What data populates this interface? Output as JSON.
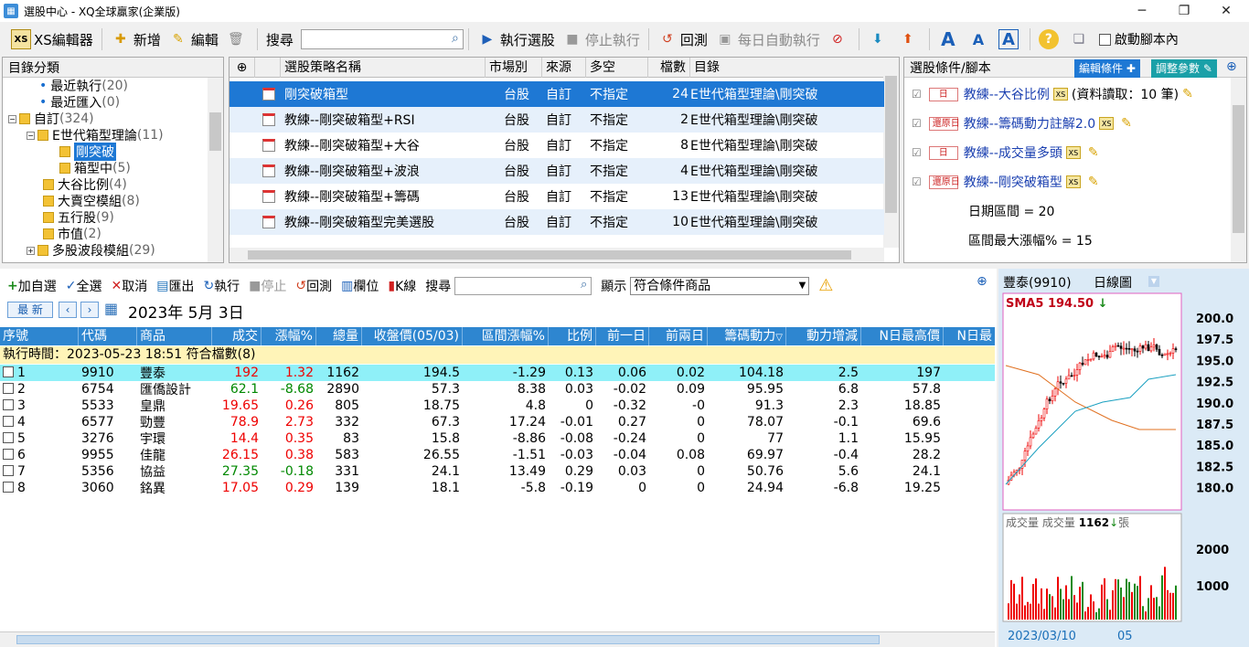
{
  "window": {
    "title": "選股中心 - XQ全球贏家(企業版)",
    "minimize": "─",
    "maximize": "❐",
    "close": "✕"
  },
  "toolbar": {
    "xs_editor": "XS編輯器",
    "add": "新增",
    "edit": "編輯",
    "search_label": "搜尋",
    "run": "執行選股",
    "stop": "停止執行",
    "backtest": "回測",
    "daily_auto": "每日自動執行",
    "autostart": "啟動腳本內"
  },
  "tree": {
    "header": "目錄分類",
    "items": [
      {
        "label": "最近執行",
        "count": "(20)"
      },
      {
        "label": "最近匯入",
        "count": "(0)"
      },
      {
        "label": "自訂",
        "count": "(324)"
      },
      {
        "label": "E世代箱型理論",
        "count": "(11)"
      },
      {
        "label": "剛突破",
        "count": ""
      },
      {
        "label": "箱型中",
        "count": "(5)"
      },
      {
        "label": "大谷比例",
        "count": "(4)"
      },
      {
        "label": "大賣空模組",
        "count": "(8)"
      },
      {
        "label": "五行股",
        "count": "(9)"
      },
      {
        "label": "市值",
        "count": "(2)"
      },
      {
        "label": "多股波段模組",
        "count": "(29)"
      }
    ]
  },
  "strategies": {
    "columns": [
      "選股策略名稱",
      "市場別",
      "來源",
      "多空",
      "檔數",
      "目錄"
    ],
    "rows": [
      {
        "name": "剛突破箱型",
        "market": "台股",
        "source": "自訂",
        "ls": "不指定",
        "count": "24",
        "dir": "E世代箱型理論\\剛突破"
      },
      {
        "name": "教練--剛突破箱型+RSI",
        "market": "台股",
        "source": "自訂",
        "ls": "不指定",
        "count": "2",
        "dir": "E世代箱型理論\\剛突破"
      },
      {
        "name": "教練--剛突破箱型+大谷",
        "market": "台股",
        "source": "自訂",
        "ls": "不指定",
        "count": "8",
        "dir": "E世代箱型理論\\剛突破"
      },
      {
        "name": "教練--剛突破箱型+波浪",
        "market": "台股",
        "source": "自訂",
        "ls": "不指定",
        "count": "4",
        "dir": "E世代箱型理論\\剛突破"
      },
      {
        "name": "教練--剛突破箱型+籌碼",
        "market": "台股",
        "source": "自訂",
        "ls": "不指定",
        "count": "13",
        "dir": "E世代箱型理論\\剛突破"
      },
      {
        "name": "教練--剛突破箱型完美選股",
        "market": "台股",
        "source": "自訂",
        "ls": "不指定",
        "count": "10",
        "dir": "E世代箱型理論\\剛突破"
      }
    ]
  },
  "conditions": {
    "header": "選股條件/腳本",
    "edit_btn": "編輯條件",
    "param_btn": "調整參數",
    "items": [
      {
        "tag": "日",
        "name": "教練--大谷比例",
        "extra": "(資料讀取：10 筆)"
      },
      {
        "tag": "還原日",
        "name": "教練--籌碼動力註解2.0",
        "extra": ""
      },
      {
        "tag": "日",
        "name": "教練--成交量多頭",
        "extra": ""
      },
      {
        "tag": "還原日",
        "name": "教練--剛突破箱型",
        "extra": ""
      }
    ],
    "params": [
      "日期區間 = 20",
      "區間最大漲幅% = 15"
    ]
  },
  "results_toolbar": {
    "add_fav": "加自選",
    "select_all": "全選",
    "cancel": "取消",
    "export": "匯出",
    "run": "執行",
    "stop": "停止",
    "backtest": "回測",
    "columns": "欄位",
    "kline": "K線",
    "search": "搜尋",
    "display": "顯示",
    "display_value": "符合條件商品"
  },
  "date_nav": {
    "latest": "最 新",
    "date": "2023年  5月  3日"
  },
  "results": {
    "columns": [
      "序號",
      "代碼",
      "商品",
      "成交",
      "漲幅%",
      "總量",
      "收盤價(05/03)",
      "區間漲幅%",
      "比例",
      "前一日",
      "前兩日",
      "籌碼動力",
      "動力增減",
      "N日最高價",
      "N日最"
    ],
    "exec_info": "執行時間：2023-05-23 18:51 符合檔數(8)",
    "rows": [
      {
        "n": "1",
        "code": "9910",
        "name": "豐泰",
        "price": "192",
        "chg": "1.32",
        "vol": "1162",
        "close": "194.5",
        "range": "-1.29",
        "ratio": "0.13",
        "d1": "0.06",
        "d2": "0.02",
        "chip": "104.18",
        "delta": "2.5",
        "high": "197",
        "c": "red"
      },
      {
        "n": "2",
        "code": "6754",
        "name": "匯僑設計",
        "price": "62.1",
        "chg": "-8.68",
        "vol": "2890",
        "close": "57.3",
        "range": "8.38",
        "ratio": "0.03",
        "d1": "-0.02",
        "d2": "0.09",
        "chip": "95.95",
        "delta": "6.8",
        "high": "57.8",
        "c": "grn"
      },
      {
        "n": "3",
        "code": "5533",
        "name": "皇鼎",
        "price": "19.65",
        "chg": "0.26",
        "vol": "805",
        "close": "18.75",
        "range": "4.8",
        "ratio": "0",
        "d1": "-0.32",
        "d2": "-0",
        "chip": "91.3",
        "delta": "2.3",
        "high": "18.85",
        "c": "red"
      },
      {
        "n": "4",
        "code": "6577",
        "name": "勁豐",
        "price": "78.9",
        "chg": "2.73",
        "vol": "332",
        "close": "67.3",
        "range": "17.24",
        "ratio": "-0.01",
        "d1": "0.27",
        "d2": "0",
        "chip": "78.07",
        "delta": "-0.1",
        "high": "69.6",
        "c": "red"
      },
      {
        "n": "5",
        "code": "3276",
        "name": "宇環",
        "price": "14.4",
        "chg": "0.35",
        "vol": "83",
        "close": "15.8",
        "range": "-8.86",
        "ratio": "-0.08",
        "d1": "-0.24",
        "d2": "0",
        "chip": "77",
        "delta": "1.1",
        "high": "15.95",
        "c": "red"
      },
      {
        "n": "6",
        "code": "9955",
        "name": "佳龍",
        "price": "26.15",
        "chg": "0.38",
        "vol": "583",
        "close": "26.55",
        "range": "-1.51",
        "ratio": "-0.03",
        "d1": "-0.04",
        "d2": "0.08",
        "chip": "69.97",
        "delta": "-0.4",
        "high": "28.2",
        "c": "red"
      },
      {
        "n": "7",
        "code": "5356",
        "name": "協益",
        "price": "27.35",
        "chg": "-0.18",
        "vol": "331",
        "close": "24.1",
        "range": "13.49",
        "ratio": "0.29",
        "d1": "0.03",
        "d2": "0",
        "chip": "50.76",
        "delta": "5.6",
        "high": "24.1",
        "c": "grn"
      },
      {
        "n": "8",
        "code": "3060",
        "name": "銘異",
        "price": "17.05",
        "chg": "0.29",
        "vol": "139",
        "close": "18.1",
        "range": "-5.8",
        "ratio": "-0.19",
        "d1": "0",
        "d2": "0",
        "chip": "24.94",
        "delta": "-6.8",
        "high": "19.25",
        "c": "red"
      }
    ]
  },
  "chart": {
    "symbol": "豐泰(9910)",
    "type": "日線圖",
    "sma_label": "SMA5",
    "sma_value": "194.50",
    "price_ticks": [
      "200.0",
      "197.5",
      "195.0",
      "192.5",
      "190.0",
      "187.5",
      "185.0",
      "182.5",
      "180.0"
    ],
    "vol_label1": "成交量",
    "vol_label2": "成交量",
    "vol_value": "1162",
    "vol_unit": "張",
    "vol_ticks": [
      "2000",
      "1000"
    ],
    "date_left": "2023/03/10",
    "date_mid": "05"
  }
}
